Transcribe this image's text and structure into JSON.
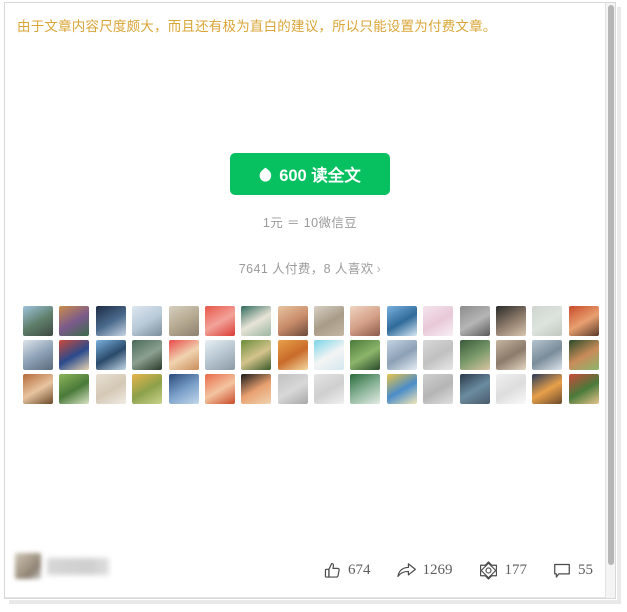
{
  "notice": {
    "text": "由于文章内容尺度颇大，而且还有极为直白的建议，所以只能设置为付费文章。",
    "color": "#d9a536"
  },
  "paywall": {
    "button": {
      "icon": "wechat-bean-icon",
      "price": "600",
      "label": "读全文",
      "full_label": "600 读全文",
      "background_color": "#07c160",
      "text_color": "#ffffff"
    },
    "price_note": "1元 ＝ 10微信豆",
    "pay_summary": {
      "paid_count": "7641",
      "text": "7641 人付费，8 人喜欢",
      "liked_count": "8",
      "chevron": "›"
    }
  },
  "avatar_grid": {
    "columns": 16,
    "rows": 3,
    "avatars": [
      {
        "name": "avatar-1",
        "colors": [
          "#9fc4dd",
          "#5f7f6a",
          "#3d4a42"
        ]
      },
      {
        "name": "avatar-2",
        "colors": [
          "#c98c4a",
          "#7b5a8c",
          "#3b6b4a"
        ]
      },
      {
        "name": "avatar-3",
        "colors": [
          "#1d2b44",
          "#4a6a8c",
          "#c9d6e4"
        ]
      },
      {
        "name": "avatar-4",
        "colors": [
          "#dde7f0",
          "#b8c9d8",
          "#7b8c9a"
        ]
      },
      {
        "name": "avatar-5",
        "colors": [
          "#d6cfc0",
          "#b5a890",
          "#8c8070"
        ]
      },
      {
        "name": "avatar-6",
        "colors": [
          "#e8564a",
          "#f2a39a",
          "#d93b33"
        ]
      },
      {
        "name": "avatar-7",
        "colors": [
          "#2f6b5a",
          "#e8e4d8",
          "#9ab5a0"
        ]
      },
      {
        "name": "avatar-8",
        "colors": [
          "#e8c4a0",
          "#c98c6a",
          "#6b4a3a"
        ]
      },
      {
        "name": "avatar-9",
        "colors": [
          "#d8d0c4",
          "#a89c88",
          "#c4b8a4"
        ]
      },
      {
        "name": "avatar-10",
        "colors": [
          "#f0d4c0",
          "#d4a088",
          "#8c5a4a"
        ]
      },
      {
        "name": "avatar-11",
        "colors": [
          "#7ab0dd",
          "#2f6b9a",
          "#d8e8f4"
        ]
      },
      {
        "name": "avatar-12",
        "colors": [
          "#f4e4ec",
          "#e8c8d8",
          "#f8f0f4"
        ]
      },
      {
        "name": "avatar-13",
        "colors": [
          "#8c8c8c",
          "#b5b5b5",
          "#5a5a5a"
        ]
      },
      {
        "name": "avatar-14",
        "colors": [
          "#2a2a2a",
          "#8c7a6a",
          "#d8c4b0"
        ]
      },
      {
        "name": "avatar-15",
        "colors": [
          "#cfd6cf",
          "#dde4dd",
          "#c0c8c0"
        ]
      },
      {
        "name": "avatar-16",
        "colors": [
          "#c94a2a",
          "#e8a070",
          "#5a3a2a"
        ]
      },
      {
        "name": "avatar-17",
        "colors": [
          "#dde4ec",
          "#8ca0b5",
          "#5a6b7a"
        ]
      },
      {
        "name": "avatar-18",
        "colors": [
          "#c94a3a",
          "#2a4a8c",
          "#e8d4b0"
        ]
      },
      {
        "name": "avatar-19",
        "colors": [
          "#7ab0dd",
          "#2a4a6b",
          "#c4d8e8"
        ]
      },
      {
        "name": "avatar-20",
        "colors": [
          "#4a6b5a",
          "#8ca090",
          "#2a3a2a"
        ]
      },
      {
        "name": "avatar-21",
        "colors": [
          "#e84a4a",
          "#f0d4b0",
          "#c98c5a"
        ]
      },
      {
        "name": "avatar-22",
        "colors": [
          "#e8f0f4",
          "#b5c4cf",
          "#8c9aa4"
        ]
      },
      {
        "name": "avatar-23",
        "colors": [
          "#6b8c3a",
          "#d4c48c",
          "#3a5a2a"
        ]
      },
      {
        "name": "avatar-24",
        "colors": [
          "#e8a04a",
          "#c96b2a",
          "#f4d8a0"
        ]
      },
      {
        "name": "avatar-25",
        "colors": [
          "#7ad4e8",
          "#f4f4f4",
          "#d4e8f0"
        ]
      },
      {
        "name": "avatar-26",
        "colors": [
          "#4a7a3a",
          "#8cb56b",
          "#2a4a2a"
        ]
      },
      {
        "name": "avatar-27",
        "colors": [
          "#c4d4e4",
          "#8ca0b5",
          "#e4ecf4"
        ]
      },
      {
        "name": "avatar-28",
        "colors": [
          "#d8d8d8",
          "#c0c0c0",
          "#e8e8e8"
        ]
      },
      {
        "name": "avatar-29",
        "colors": [
          "#3a5a3a",
          "#7a9a6b",
          "#d8c4a0"
        ]
      },
      {
        "name": "avatar-30",
        "colors": [
          "#c4b5a0",
          "#8c7a6a",
          "#e4d8c4"
        ]
      },
      {
        "name": "avatar-31",
        "colors": [
          "#b5c4cf",
          "#7a8c9a",
          "#dde4ec"
        ]
      },
      {
        "name": "avatar-32",
        "colors": [
          "#2a4a2a",
          "#c98c5a",
          "#8cb56b"
        ]
      },
      {
        "name": "avatar-33",
        "colors": [
          "#b56b3a",
          "#e8c4a0",
          "#6b4a2a"
        ]
      },
      {
        "name": "avatar-34",
        "colors": [
          "#8cb55a",
          "#4a7a3a",
          "#d8e4c4"
        ]
      },
      {
        "name": "avatar-35",
        "colors": [
          "#e8e0d4",
          "#d4c8b5",
          "#f0ece4"
        ]
      },
      {
        "name": "avatar-36",
        "colors": [
          "#e8b54a",
          "#8ca04a",
          "#c9d48c"
        ]
      },
      {
        "name": "avatar-37",
        "colors": [
          "#2a4a7a",
          "#7aa0c9",
          "#c4d8ec"
        ]
      },
      {
        "name": "avatar-38",
        "colors": [
          "#e86b4a",
          "#f4c4a0",
          "#c94a2a"
        ]
      },
      {
        "name": "avatar-39",
        "colors": [
          "#1a1a1a",
          "#e8a070",
          "#f0d4b0"
        ]
      },
      {
        "name": "avatar-40",
        "colors": [
          "#c0c0c0",
          "#d8d8d8",
          "#a8a8a8"
        ]
      },
      {
        "name": "avatar-41",
        "colors": [
          "#e4e4e4",
          "#cfcfcf",
          "#f0f0f0"
        ]
      },
      {
        "name": "avatar-42",
        "colors": [
          "#2a6b3a",
          "#8cb59a",
          "#e4ece4"
        ]
      },
      {
        "name": "avatar-43",
        "colors": [
          "#e8c44a",
          "#4a8cc9",
          "#f4e8b5"
        ]
      },
      {
        "name": "avatar-44",
        "colors": [
          "#cfcfcf",
          "#b5b5b5",
          "#e0e0e0"
        ]
      },
      {
        "name": "avatar-45",
        "colors": [
          "#2a3a4a",
          "#6b8ca0",
          "#4a5a6b"
        ]
      },
      {
        "name": "avatar-46",
        "colors": [
          "#f0f0f0",
          "#dddddd",
          "#fafafa"
        ]
      },
      {
        "name": "avatar-47",
        "colors": [
          "#2a3a5a",
          "#e8a04a",
          "#6b4a2a"
        ]
      },
      {
        "name": "avatar-48",
        "colors": [
          "#c94a3a",
          "#4a7a3a",
          "#e8c48c"
        ]
      }
    ]
  },
  "author": {
    "name_redacted": "",
    "avatar_redacted": true
  },
  "actions": [
    {
      "name": "like-action",
      "icon": "thumbs-up-icon",
      "count": "674"
    },
    {
      "name": "share-action",
      "icon": "share-arrow-icon",
      "count": "1269"
    },
    {
      "name": "wow-action",
      "icon": "wow-flower-icon",
      "count": "177"
    },
    {
      "name": "comment-action",
      "icon": "comment-bubble-icon",
      "count": "55"
    }
  ]
}
